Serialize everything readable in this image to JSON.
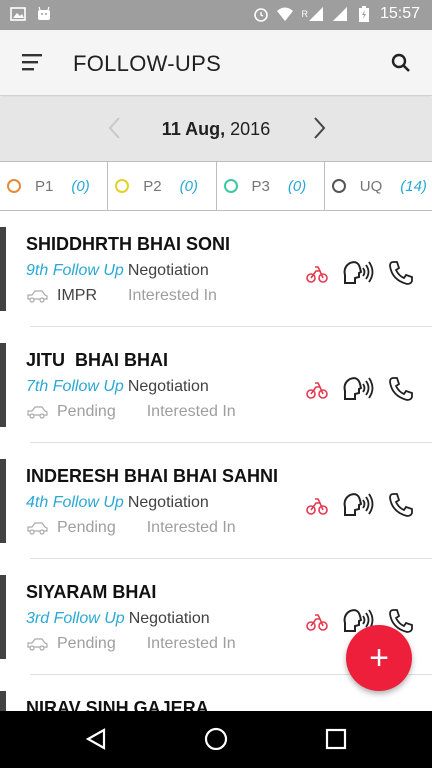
{
  "status_bar": {
    "time": "15:57",
    "network_label": "R"
  },
  "app_bar": {
    "title": "FOLLOW-UPS"
  },
  "date_nav": {
    "day_month": "11 Aug,",
    "year": " 2016"
  },
  "priority_tabs": [
    {
      "label": "P1",
      "count": "(0)",
      "color": "#e8883a"
    },
    {
      "label": "P2",
      "count": "(0)",
      "color": "#e6d02a"
    },
    {
      "label": "P3",
      "count": "(0)",
      "color": "#3cc9a0"
    },
    {
      "label": "UQ",
      "count": "(14)",
      "color": "#555555"
    }
  ],
  "followups": [
    {
      "name": "SHIDDHRTH BHAI SONI",
      "followup": "9th Follow Up",
      "stage": "Negotiation",
      "status": "IMPR",
      "interest": "Interested In"
    },
    {
      "name": "JITU  BHAI BHAI",
      "followup": "7th Follow Up",
      "stage": "Negotiation",
      "status": "Pending",
      "interest": "Interested In"
    },
    {
      "name": "INDERESH BHAI BHAI SAHNI",
      "followup": "4th Follow Up",
      "stage": "Negotiation",
      "status": "Pending",
      "interest": "Interested In"
    },
    {
      "name": "SIYARAM BHAI",
      "followup": "3rd Follow Up",
      "stage": "Negotiation",
      "status": "Pending",
      "interest": "Interested In"
    },
    {
      "name": "NIRAV SINH GAJERA",
      "followup": "",
      "stage": "",
      "status": "",
      "interest": ""
    }
  ],
  "fab": {
    "label": "+"
  },
  "colors": {
    "accent": "#29a8d6",
    "fab": "#ee1f3a",
    "bike_icon": "#e53950"
  }
}
